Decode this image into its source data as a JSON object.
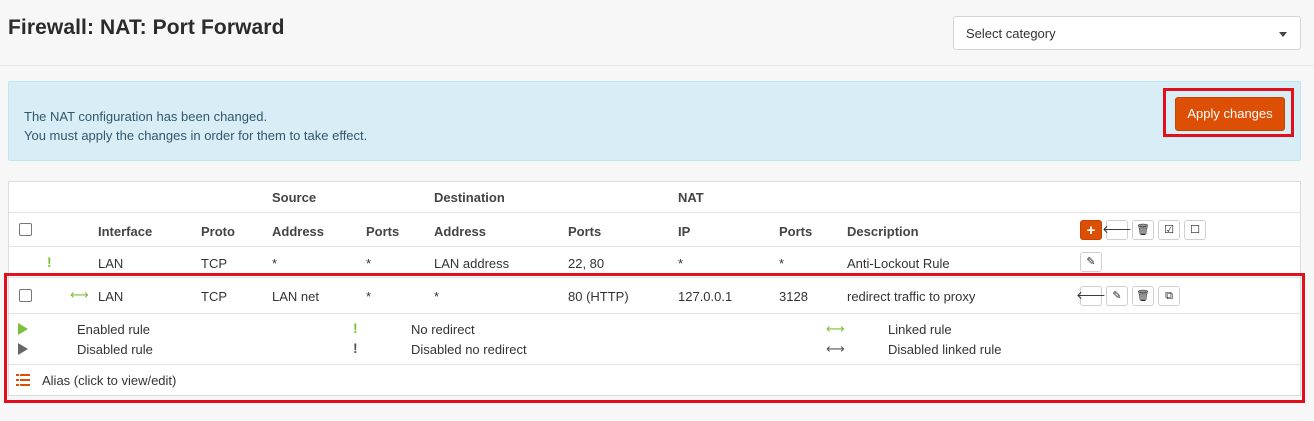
{
  "page": {
    "title": "Firewall: NAT: Port Forward"
  },
  "category_select": {
    "value": "Select category"
  },
  "alert": {
    "line1": "The NAT configuration has been changed.",
    "line2": "You must apply the changes in order for them to take effect.",
    "apply_label": "Apply changes"
  },
  "table": {
    "group_headers": {
      "source": "Source",
      "destination": "Destination",
      "nat": "NAT"
    },
    "headers": {
      "interface": "Interface",
      "proto": "Proto",
      "src_address": "Address",
      "src_ports": "Ports",
      "dst_address": "Address",
      "dst_ports": "Ports",
      "nat_ip": "IP",
      "nat_ports": "Ports",
      "description": "Description"
    },
    "rows": [
      {
        "status_icon": "no-redirect-icon",
        "interface": "LAN",
        "proto": "TCP",
        "src_address": "*",
        "src_ports": "*",
        "dst_address": "LAN address",
        "dst_ports": "22, 80",
        "nat_ip": "*",
        "nat_ports": "*",
        "description": "Anti-Lockout Rule"
      },
      {
        "status_icon": "linked-rule-icon",
        "interface": "LAN",
        "proto": "TCP",
        "src_address": "LAN net",
        "src_ports": "*",
        "dst_address": "*",
        "dst_ports": "80 (HTTP)",
        "nat_ip": "127.0.0.1",
        "nat_ports": "3128",
        "description": "redirect traffic to proxy"
      }
    ]
  },
  "legend": {
    "enabled_rule": "Enabled rule",
    "disabled_rule": "Disabled rule",
    "no_redirect": "No redirect",
    "disabled_no_redirect": "Disabled no redirect",
    "linked_rule": "Linked rule",
    "disabled_linked_rule": "Disabled linked rule",
    "alias": "Alias (click to view/edit)"
  },
  "colors": {
    "accent": "#dd4f05",
    "enabled": "#7cbf3b",
    "alert_bg": "#d9edf7",
    "highlight": "#e2101c"
  },
  "glyphs": {
    "add": "+",
    "arrow_left": "🡐",
    "edit": "✎",
    "delete": "🗑",
    "check": "☑",
    "square": "☐",
    "clone": "⧉",
    "excl": "!",
    "link": "⟷"
  }
}
